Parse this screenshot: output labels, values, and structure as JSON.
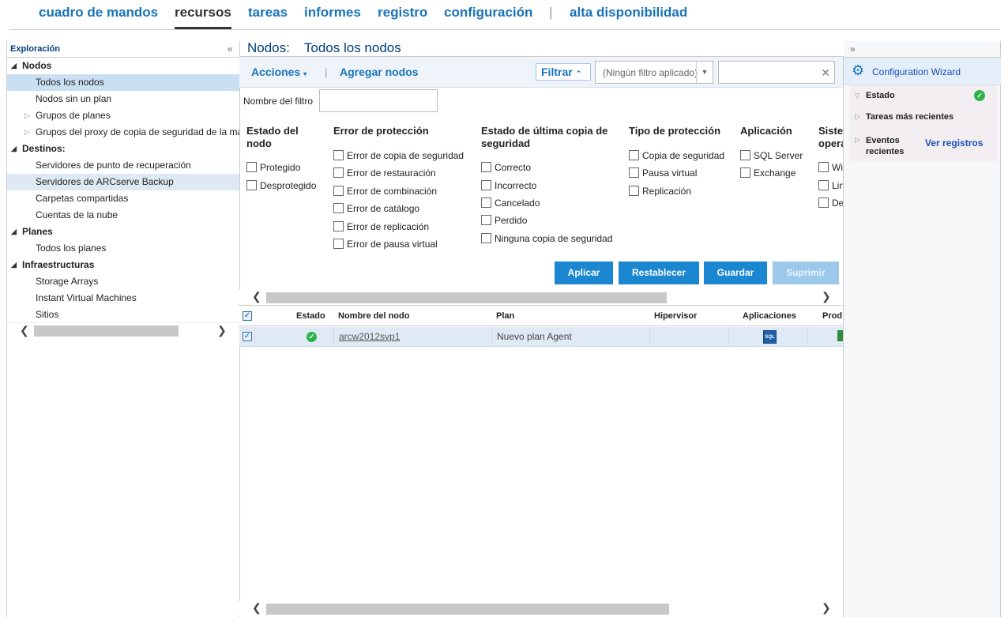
{
  "nav": {
    "items": [
      "cuadro de mandos",
      "recursos",
      "tareas",
      "informes",
      "registro",
      "configuración",
      "alta disponibilidad"
    ],
    "active": "recursos",
    "separator": "|"
  },
  "left": {
    "header": "Exploración",
    "collapse_glyph": "«",
    "tree": {
      "nodos": "Nodos",
      "todos_los_nodos": "Todos los nodos",
      "nodos_sin_plan": "Nodos sin un plan",
      "grupos_de_planes": "Grupos de planes",
      "grupos_proxy": "Grupos del proxy de copia de seguridad de la máquina virtual",
      "destinos": "Destinos:",
      "servidores_rps": "Servidores de punto de recuperación",
      "servidores_arcserve": "Servidores de ARCserve Backup",
      "carpetas": "Carpetas compartidas",
      "cuentas_nube": "Cuentas de la nube",
      "planes": "Planes",
      "todos_los_planes": "Todos los planes",
      "infraestructuras": "Infraestructuras",
      "storage_arrays": "Storage Arrays",
      "instant_vm": "Instant Virtual Machines",
      "sitios": "Sitios"
    }
  },
  "main": {
    "title": "Nodos:",
    "subtitle": "Todos los nodos",
    "toolbar": {
      "actions": "Acciones",
      "separator": "|",
      "add_nodes": "Agregar nodos",
      "filter": "Filtrar",
      "filter_select_placeholder": "(Ningún filtro aplicado)",
      "search_value": ""
    },
    "filter_name_label": "Nombre del filtro",
    "filter_name_value": "",
    "filters": {
      "estado_nodo": {
        "title_line1": "Estado del",
        "title_line2": "nodo",
        "options": [
          "Protegido",
          "Desprotegido"
        ]
      },
      "error_proteccion": {
        "title": "Error de protección",
        "options": [
          "Error de copia de seguridad",
          "Error de restauración",
          "Error de combinación",
          "Error de catálogo",
          "Error de replicación",
          "Error de pausa virtual"
        ]
      },
      "estado_ultima_copia": {
        "title_line1": "Estado de última copia de",
        "title_line2": "seguridad",
        "options": [
          "Correcto",
          "Incorrecto",
          "Cancelado",
          "Perdido",
          "Ninguna copia de seguridad"
        ]
      },
      "tipo_proteccion": {
        "title": "Tipo de protección",
        "options": [
          "Copia de seguridad",
          "Pausa virtual",
          "Replicación"
        ]
      },
      "aplicacion": {
        "title": "Aplicación",
        "options": [
          "SQL Server",
          "Exchange"
        ]
      },
      "sistema_operativo": {
        "title_line1": "Siste",
        "title_line2": "opera",
        "options": [
          "Wi",
          "Lin",
          "De"
        ]
      }
    },
    "buttons": {
      "apply": "Aplicar",
      "reset": "Restablecer",
      "save": "Guardar",
      "delete": "Suprimir"
    },
    "grid": {
      "columns": [
        "Estado",
        "Nombre del nodo",
        "Plan",
        "Hipervisor",
        "Aplicaciones",
        "Prod"
      ],
      "rows": [
        {
          "estado": "ok",
          "nombre": "arcw2012svp1",
          "plan": "Nuevo plan Agent",
          "hipervisor": "",
          "aplicaciones": "SQL"
        }
      ]
    }
  },
  "right": {
    "expand_glyph": "»",
    "wizard": "Configuration Wizard",
    "estado": "Estado",
    "tareas_recientes": "Tareas más recientes",
    "eventos_line1": "Eventos",
    "eventos_line2": "recientes",
    "ver_registros": "Ver registros"
  },
  "colors": {
    "accent": "#1a73b8",
    "button": "#1a87d0",
    "selected_row": "#c9e0f3",
    "ok": "#2eb34a"
  }
}
